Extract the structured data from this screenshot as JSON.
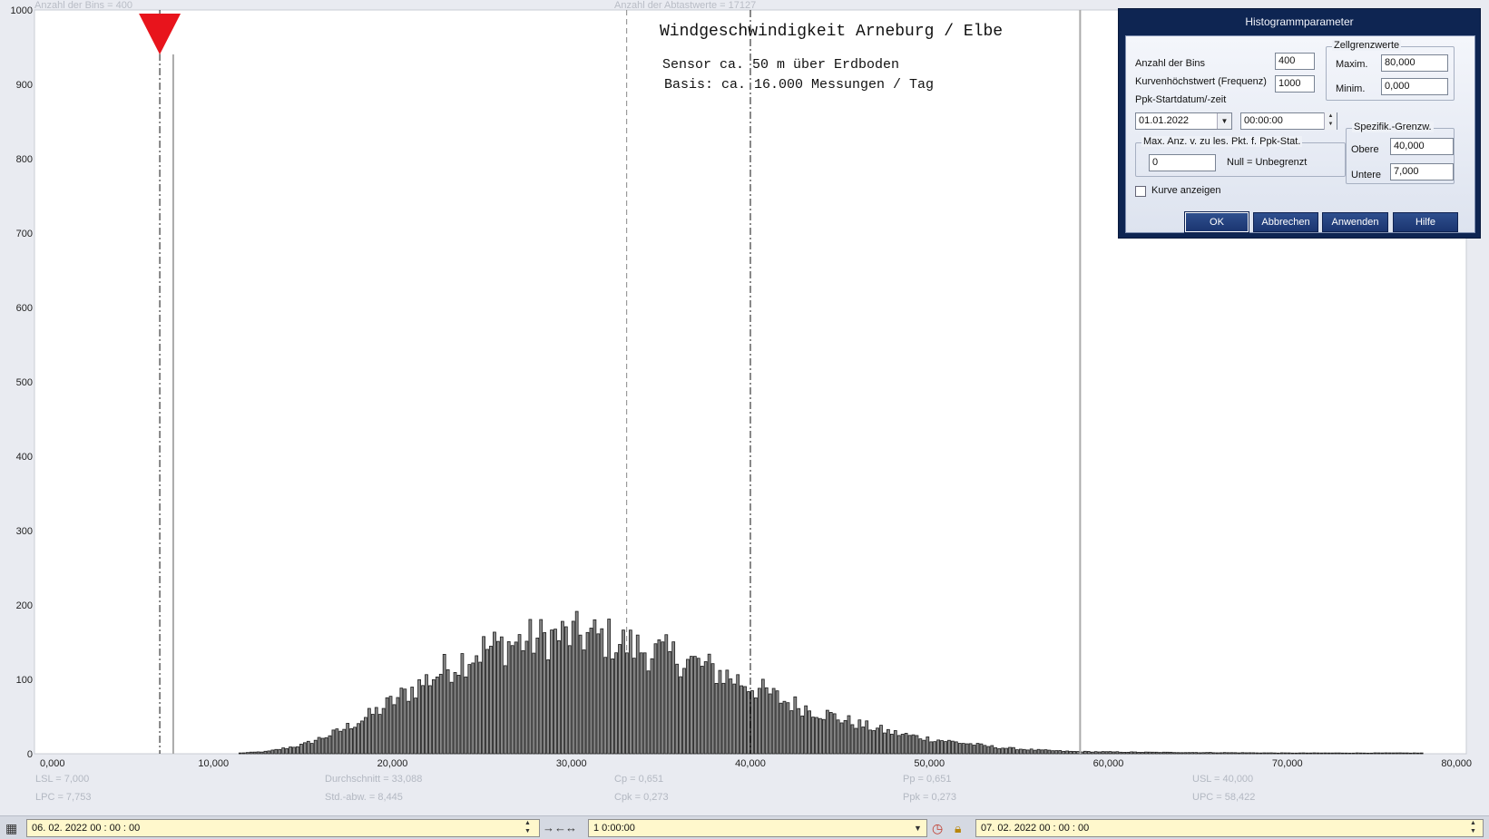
{
  "top_labels": {
    "bins_text": "Anzahl der Bins =   400",
    "samples_text": "Anzahl der Abtastwerte = 17127"
  },
  "chart_title": {
    "line1": "Windgeschwindigkeit  Arneburg / Elbe",
    "line2": "Sensor ca. 50 m über Erdboden",
    "line3": "Basis: ca. 16.000 Messungen / Tag"
  },
  "chart_data": {
    "type": "bar",
    "x_range": [
      0,
      80
    ],
    "y_range": [
      0,
      1000
    ],
    "y_ticks": [
      "0",
      "100",
      "200",
      "300",
      "400",
      "500",
      "600",
      "700",
      "800",
      "900",
      "1000"
    ],
    "x_ticks": [
      "0,000",
      "10,000",
      "20,000",
      "30,000",
      "40,000",
      "50,000",
      "60,000",
      "70,000",
      "80,000"
    ],
    "bin_count": 400,
    "mean": 33.088,
    "std": 8.445,
    "distribution_anchors": [
      [
        11.5,
        1
      ],
      [
        13,
        3
      ],
      [
        15,
        12
      ],
      [
        17,
        30
      ],
      [
        19,
        55
      ],
      [
        21,
        85
      ],
      [
        23,
        115
      ],
      [
        25,
        140
      ],
      [
        27,
        150
      ],
      [
        29,
        158
      ],
      [
        30.5,
        160
      ],
      [
        32,
        155
      ],
      [
        34,
        140
      ],
      [
        36,
        130
      ],
      [
        38,
        112
      ],
      [
        40,
        92
      ],
      [
        42,
        70
      ],
      [
        44,
        55
      ],
      [
        46,
        40
      ],
      [
        48,
        28
      ],
      [
        50,
        20
      ],
      [
        52,
        14
      ],
      [
        54,
        8
      ],
      [
        56,
        5
      ],
      [
        58,
        3
      ],
      [
        62,
        2
      ],
      [
        70,
        1
      ],
      [
        77.5,
        1
      ]
    ],
    "markers": {
      "lsl": 7.0,
      "lpc": 7.753,
      "mean": 33.088,
      "usl": 40.0,
      "upc": 58.422
    }
  },
  "stats": {
    "lsl": "LSL = 7,000",
    "lpc": "LPC = 7,753",
    "mean": "Durchschnitt  = 33,088",
    "std": "Std.-abw.  = 8,445",
    "cp": "Cp  = 0,651",
    "cpk": "Cpk = 0,273",
    "pp": "Pp  = 0,651",
    "ppk": "Ppk = 0,273",
    "usl": "USL = 40,000",
    "upc": "UPC = 58,422"
  },
  "dialog": {
    "title": "Histogrammparameter",
    "bins_label": "Anzahl der Bins",
    "bins_value": "400",
    "curve_max_label": "Kurvenhöchstwert (Frequenz)",
    "curve_max_value": "1000",
    "ppk_start_label": "Ppk-Startdatum/-zeit",
    "start_date": "01.01.2022",
    "start_time": "00:00:00",
    "cell_limits_title": "Zellgrenzwerte",
    "max_label": "Maxim.",
    "max_value": "80,000",
    "min_label": "Minim.",
    "min_value": "0,000",
    "max_points_title": "Max. Anz. v. zu les. Pkt. f. Ppk-Stat.",
    "max_points_value": "0",
    "null_note": "Null = Unbegrenzt",
    "spec_title": "Spezifik.-Grenzw.",
    "upper_label": "Obere",
    "upper_value": "40,000",
    "lower_label": "Untere",
    "lower_value": "7,000",
    "show_curve_label": "Kurve anzeigen",
    "ok": "OK",
    "cancel": "Abbrechen",
    "apply": "Anwenden",
    "help": "Hilfe"
  },
  "bottom_bar": {
    "start_datetime": "06. 02. 2022    00 : 00 : 00",
    "interval": "1 0:00:00",
    "end_datetime": "07. 02. 2022    00 : 00 : 00"
  },
  "colors": {
    "bar_fill": "#8a8a8a",
    "bar_stroke": "#1a1a1a",
    "marker_red": "#e8141c",
    "dialog_bg": "#0e2552",
    "field_bg": "#fff8cc"
  }
}
